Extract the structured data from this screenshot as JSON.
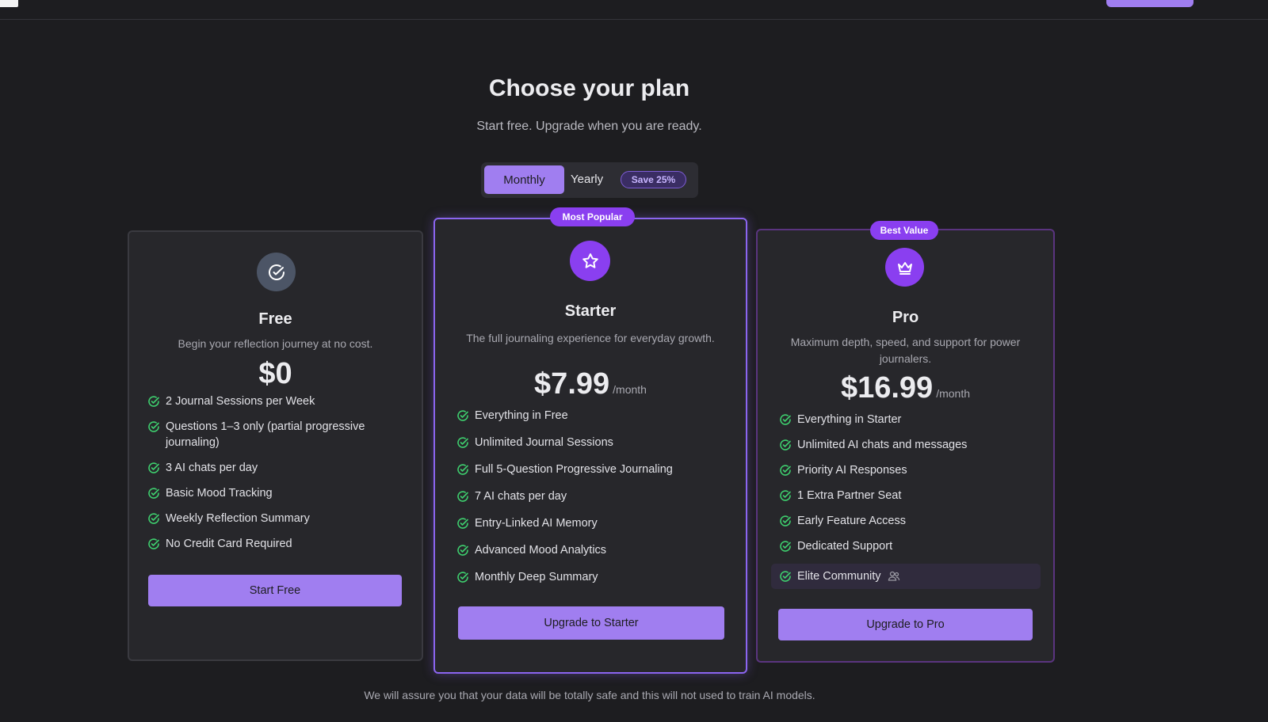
{
  "header": {
    "title": "Choose your plan",
    "subtitle": "Start free. Upgrade when you are ready."
  },
  "billing_toggle": {
    "monthly_label": "Monthly",
    "yearly_label": "Yearly",
    "save_badge": "Save 25%",
    "selected": "Monthly"
  },
  "plans": [
    {
      "name": "Free",
      "description": "Begin your reflection journey at no cost.",
      "price": "$0",
      "period": "",
      "icon": "check-circle-icon",
      "features": [
        "2 Journal Sessions per Week",
        "Questions 1–3 only (partial progressive journaling)",
        "3 AI chats per day",
        "Basic Mood Tracking",
        "Weekly Reflection Summary",
        "No Credit Card Required"
      ],
      "cta": "Start Free"
    },
    {
      "name": "Starter",
      "badge": "Most Popular",
      "description": "The full journaling experience for everyday growth.",
      "price": "$7.99",
      "period": "/month",
      "icon": "star-icon",
      "features": [
        "Everything in Free",
        "Unlimited Journal Sessions",
        "Full 5-Question Progressive Journaling",
        "7 AI chats per day",
        "Entry-Linked AI Memory",
        "Advanced Mood Analytics",
        "Monthly Deep Summary"
      ],
      "cta": "Upgrade to Starter"
    },
    {
      "name": "Pro",
      "badge": "Best Value",
      "description": "Maximum depth, speed, and support for power journalers.",
      "price": "$16.99",
      "period": "/month",
      "icon": "crown-icon",
      "features": [
        "Everything in Starter",
        "Unlimited AI chats and messages",
        "Priority AI Responses",
        "1 Extra Partner Seat",
        "Early Feature Access",
        "Dedicated Support",
        "Elite Community"
      ],
      "cta": "Upgrade to Pro"
    }
  ],
  "footer": {
    "note": "We will assure you that your data will be totally safe and this will not used to train AI models."
  },
  "colors": {
    "background": "#1d1d20",
    "accent": "#a07ef0",
    "badge": "#8a3ff0",
    "check": "#3ecf6e"
  }
}
